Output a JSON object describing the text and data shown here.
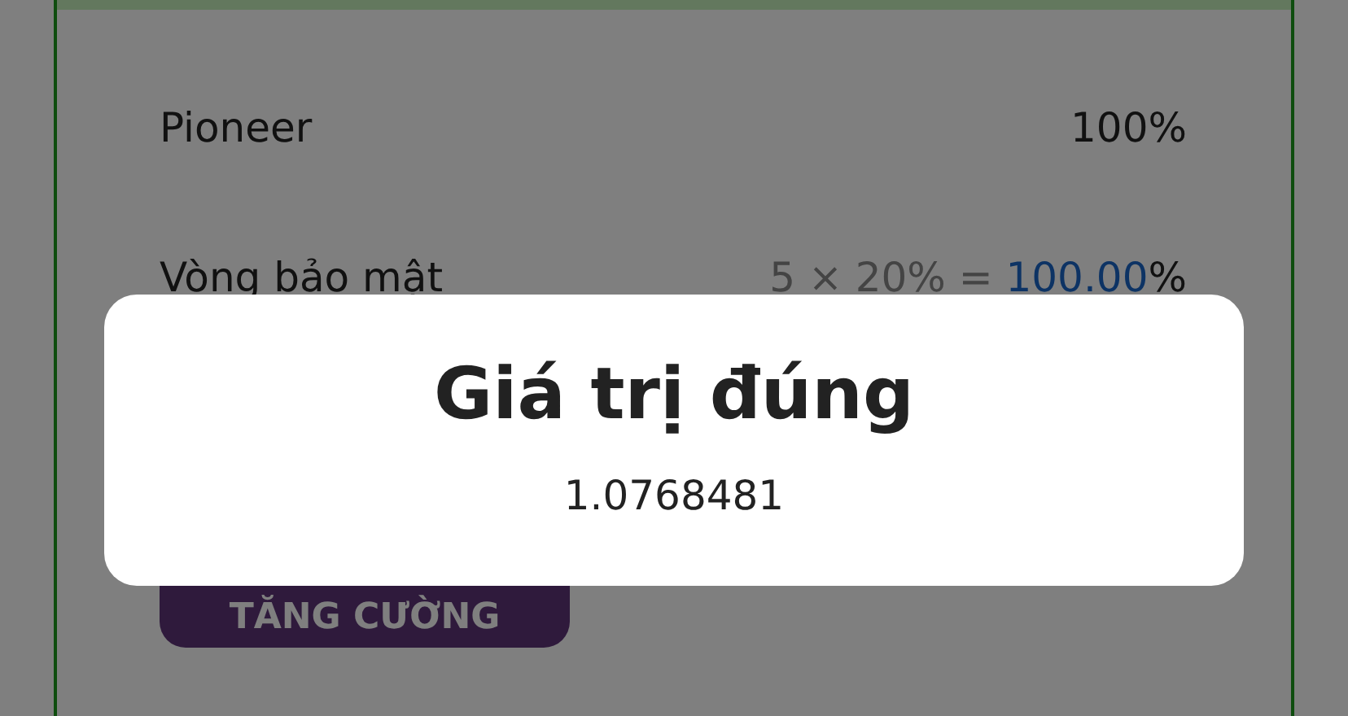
{
  "rows": [
    {
      "kind": "plain",
      "label": "Pioneer",
      "value": "100%"
    },
    {
      "kind": "formula",
      "label": "Vòng bảo mật",
      "formula": "5 × 20% = ",
      "result": "100.00",
      "unit": "%"
    }
  ],
  "button": {
    "label": "TĂNG CƯỜNG"
  },
  "dialog": {
    "title": "Giá trị đúng",
    "value": "1.0768481"
  }
}
